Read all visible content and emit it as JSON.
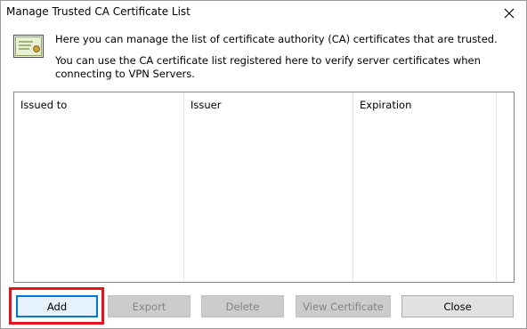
{
  "window": {
    "title": "Manage Trusted CA Certificate List",
    "close_label": "×"
  },
  "info": {
    "line1": "Here you can manage the list of certificate authority (CA) certificates that are trusted.",
    "line2": "You can use the CA certificate list registered here to verify server certificates when connecting to VPN Servers."
  },
  "list": {
    "columns": [
      "Issued to",
      "Issuer",
      "Expiration"
    ],
    "rows": []
  },
  "buttons": {
    "add": "Add",
    "export": "Export",
    "delete": "Delete",
    "view_certificate": "View Certificate",
    "close": "Close"
  },
  "icons": {
    "certificate": "certificate-icon",
    "close": "close-icon"
  },
  "colors": {
    "highlight": "#e3141b",
    "focus_border": "#0078d7",
    "disabled_text": "#838383"
  }
}
